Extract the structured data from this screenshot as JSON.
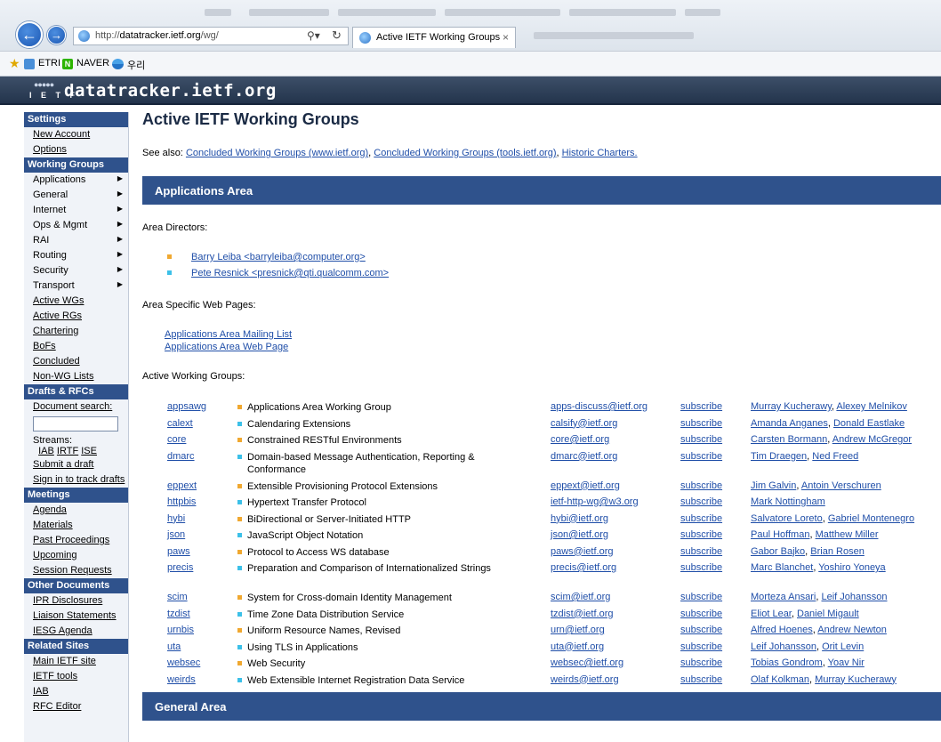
{
  "browser": {
    "url_prefix": "http://",
    "url_domain": "datatracker.ietf.org",
    "url_path": "/wg/",
    "tab_title": "Active IETF Working Groups",
    "bookmarks": [
      "ETRI",
      "NAVER",
      "우리"
    ]
  },
  "site": {
    "logo_text": "I E T F",
    "title": "datatracker.ietf.org"
  },
  "sidebar": {
    "settings": {
      "title": "Settings",
      "items": [
        "New Account",
        "Options"
      ]
    },
    "working_groups": {
      "title": "Working Groups",
      "menus": [
        "Applications",
        "General",
        "Internet",
        "Ops & Mgmt",
        "RAI",
        "Routing",
        "Security",
        "Transport"
      ],
      "links": [
        "Active WGs",
        "Active RGs",
        "Chartering",
        "BoFs",
        "Concluded",
        "Non-WG Lists"
      ]
    },
    "drafts": {
      "title": "Drafts & RFCs",
      "search_label": "Document search:",
      "streams_label": "Streams:",
      "streams": [
        "IAB",
        "IRTF",
        "ISE"
      ],
      "links": [
        "Submit a draft",
        "Sign in to track drafts"
      ]
    },
    "meetings": {
      "title": "Meetings",
      "items": [
        "Agenda",
        "Materials",
        "Past Proceedings",
        "Upcoming",
        "Session Requests"
      ]
    },
    "other_documents": {
      "title": "Other Documents",
      "items": [
        "IPR Disclosures",
        "Liaison Statements",
        "IESG Agenda"
      ]
    },
    "related_sites": {
      "title": "Related Sites",
      "items": [
        "Main IETF site",
        "IETF tools",
        "IAB",
        "RFC Editor"
      ]
    }
  },
  "main": {
    "title": "Active IETF Working Groups",
    "see_also_label": "See also:",
    "see_also_links": [
      "Concluded Working Groups (www.ietf.org)",
      "Concluded Working Groups (tools.ietf.org)",
      "Historic Charters."
    ],
    "applications_area": {
      "title": "Applications Area",
      "directors_label": "Area Directors:",
      "directors": [
        "Barry Leiba <barryleiba@computer.org>",
        "Pete Resnick <presnick@qti.qualcomm.com>"
      ],
      "web_pages_label": "Area Specific Web Pages:",
      "web_pages": [
        "Applications Area Mailing List",
        "Applications Area Web Page"
      ],
      "active_label": "Active Working Groups:",
      "groups": [
        {
          "acronym": "appsawg",
          "name": "Applications Area Working Group",
          "list": "apps-discuss@ietf.org",
          "sub": "subscribe",
          "chairs": [
            "Murray Kucherawy",
            "Alexey Melnikov"
          ]
        },
        {
          "acronym": "calext",
          "name": "Calendaring Extensions",
          "list": "calsify@ietf.org",
          "sub": "subscribe",
          "chairs": [
            "Amanda Anganes",
            "Donald Eastlake"
          ]
        },
        {
          "acronym": "core",
          "name": "Constrained RESTful Environments",
          "list": "core@ietf.org",
          "sub": "subscribe",
          "chairs": [
            "Carsten Bormann",
            "Andrew McGregor"
          ]
        },
        {
          "acronym": "dmarc",
          "name": "Domain-based Message Authentication, Reporting & Conformance",
          "list": "dmarc@ietf.org",
          "sub": "subscribe",
          "chairs": [
            "Tim Draegen",
            "Ned Freed"
          ]
        },
        {
          "acronym": "eppext",
          "name": "Extensible Provisioning Protocol Extensions",
          "list": "eppext@ietf.org",
          "sub": "subscribe",
          "chairs": [
            "Jim Galvin",
            "Antoin Verschuren"
          ]
        },
        {
          "acronym": "httpbis",
          "name": "Hypertext Transfer Protocol",
          "list": "ietf-http-wg@w3.org",
          "sub": "subscribe",
          "chairs": [
            "Mark Nottingham"
          ]
        },
        {
          "acronym": "hybi",
          "name": "BiDirectional or Server-Initiated HTTP",
          "list": "hybi@ietf.org",
          "sub": "subscribe",
          "chairs": [
            "Salvatore Loreto",
            "Gabriel Montenegro"
          ]
        },
        {
          "acronym": "json",
          "name": "JavaScript Object Notation",
          "list": "json@ietf.org",
          "sub": "subscribe",
          "chairs": [
            "Paul Hoffman",
            "Matthew Miller"
          ]
        },
        {
          "acronym": "paws",
          "name": "Protocol to Access WS database",
          "list": "paws@ietf.org",
          "sub": "subscribe",
          "chairs": [
            "Gabor Bajko",
            "Brian Rosen"
          ]
        },
        {
          "acronym": "precis",
          "name": "Preparation and Comparison of Internationalized Strings",
          "list": "precis@ietf.org",
          "sub": "subscribe",
          "chairs": [
            "Marc Blanchet",
            "Yoshiro Yoneya"
          ]
        },
        {
          "acronym": "scim",
          "name": "System for Cross-domain Identity Management",
          "list": "scim@ietf.org",
          "sub": "subscribe",
          "chairs": [
            "Morteza Ansari",
            "Leif Johansson"
          ]
        },
        {
          "acronym": "tzdist",
          "name": "Time Zone Data Distribution Service",
          "list": "tzdist@ietf.org",
          "sub": "subscribe",
          "chairs": [
            "Eliot Lear",
            "Daniel Migault"
          ]
        },
        {
          "acronym": "urnbis",
          "name": "Uniform Resource Names, Revised",
          "list": "urn@ietf.org",
          "sub": "subscribe",
          "chairs": [
            "Alfred Hoenes",
            "Andrew Newton"
          ]
        },
        {
          "acronym": "uta",
          "name": "Using TLS in Applications",
          "list": "uta@ietf.org",
          "sub": "subscribe",
          "chairs": [
            "Leif Johansson",
            "Orit Levin"
          ]
        },
        {
          "acronym": "websec",
          "name": "Web Security",
          "list": "websec@ietf.org",
          "sub": "subscribe",
          "chairs": [
            "Tobias Gondrom",
            "Yoav Nir"
          ]
        },
        {
          "acronym": "weirds",
          "name": "Web Extensible Internet Registration Data Service",
          "list": "weirds@ietf.org",
          "sub": "subscribe",
          "chairs": [
            "Olaf Kolkman",
            "Murray Kucherawy"
          ]
        }
      ]
    },
    "general_area": {
      "title": "General Area"
    }
  },
  "colors": {
    "accent": "#2f528c",
    "link": "#1f4ea8",
    "bullet_a": "#f0a830",
    "bullet_b": "#3cc0e8"
  }
}
